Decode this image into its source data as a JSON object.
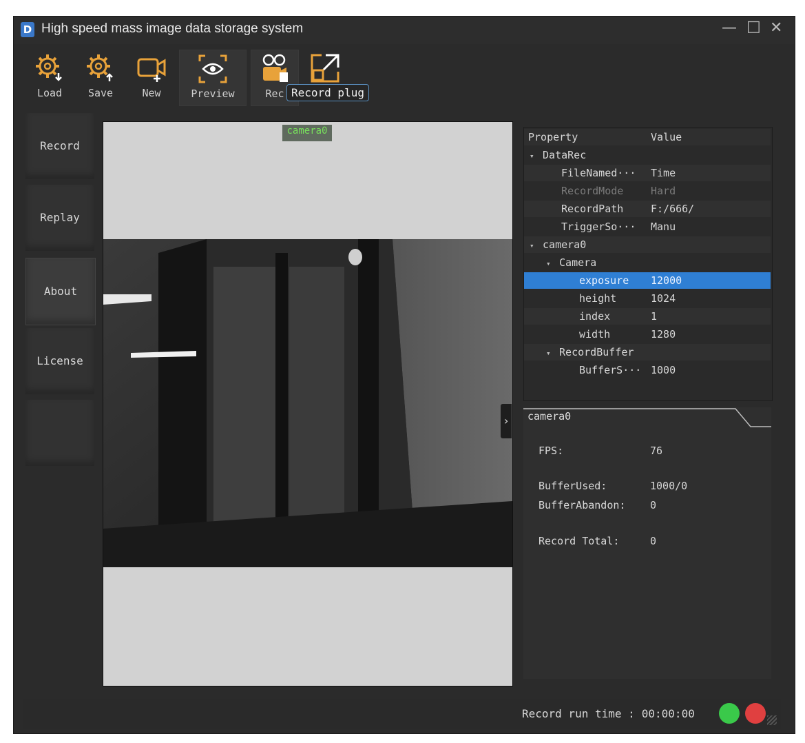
{
  "window": {
    "title": "High speed mass image data storage system",
    "app_icon": "D"
  },
  "toolbar": {
    "buttons": [
      {
        "id": "load",
        "label": "Load",
        "icon": "gear-down-icon"
      },
      {
        "id": "save",
        "label": "Save",
        "icon": "gear-up-icon"
      },
      {
        "id": "new",
        "label": "New",
        "icon": "camera-add-icon"
      },
      {
        "id": "preview",
        "label": "Preview",
        "icon": "eye-icon"
      },
      {
        "id": "rec",
        "label": "Rec",
        "icon": "film-camera-icon"
      },
      {
        "id": "external",
        "label": "",
        "icon": "external-link-icon"
      }
    ],
    "tooltip": "Record plug"
  },
  "sidebar": {
    "items": [
      "Record",
      "Replay",
      "About",
      "License"
    ]
  },
  "viewer": {
    "camera_label": "camera0"
  },
  "properties": {
    "header": {
      "property": "Property",
      "value": "Value"
    },
    "rows": [
      {
        "key": "DataRec",
        "value": ""
      },
      {
        "key": "FileNamed···",
        "value": "Time"
      },
      {
        "key": "RecordMode",
        "value": "Hard"
      },
      {
        "key": "RecordPath",
        "value": "F:/666/"
      },
      {
        "key": "TriggerSo···",
        "value": "Manu"
      },
      {
        "key": "camera0",
        "value": ""
      },
      {
        "key": "Camera",
        "value": ""
      },
      {
        "key": "exposure",
        "value": "12000"
      },
      {
        "key": "height",
        "value": "1024"
      },
      {
        "key": "index",
        "value": "1"
      },
      {
        "key": "width",
        "value": "1280"
      },
      {
        "key": "RecordBuffer",
        "value": ""
      },
      {
        "key": "BufferS···",
        "value": "1000"
      }
    ]
  },
  "stats": {
    "tab": "camera0",
    "fps_label": "FPS:",
    "fps": "76",
    "buffer_used_label": "BufferUsed:",
    "buffer_used": "1000/0",
    "buffer_abandon_label": "BufferAbandon:",
    "buffer_abandon": "0",
    "record_total_label": "Record Total:",
    "record_total": "0"
  },
  "statusbar": {
    "runtime_label": "Record run time :",
    "runtime": "00:00:00"
  },
  "colors": {
    "accent": "#2f7fd4",
    "status_green": "#3ac94a",
    "status_red": "#e04040",
    "icon_orange": "#e8a23a"
  }
}
